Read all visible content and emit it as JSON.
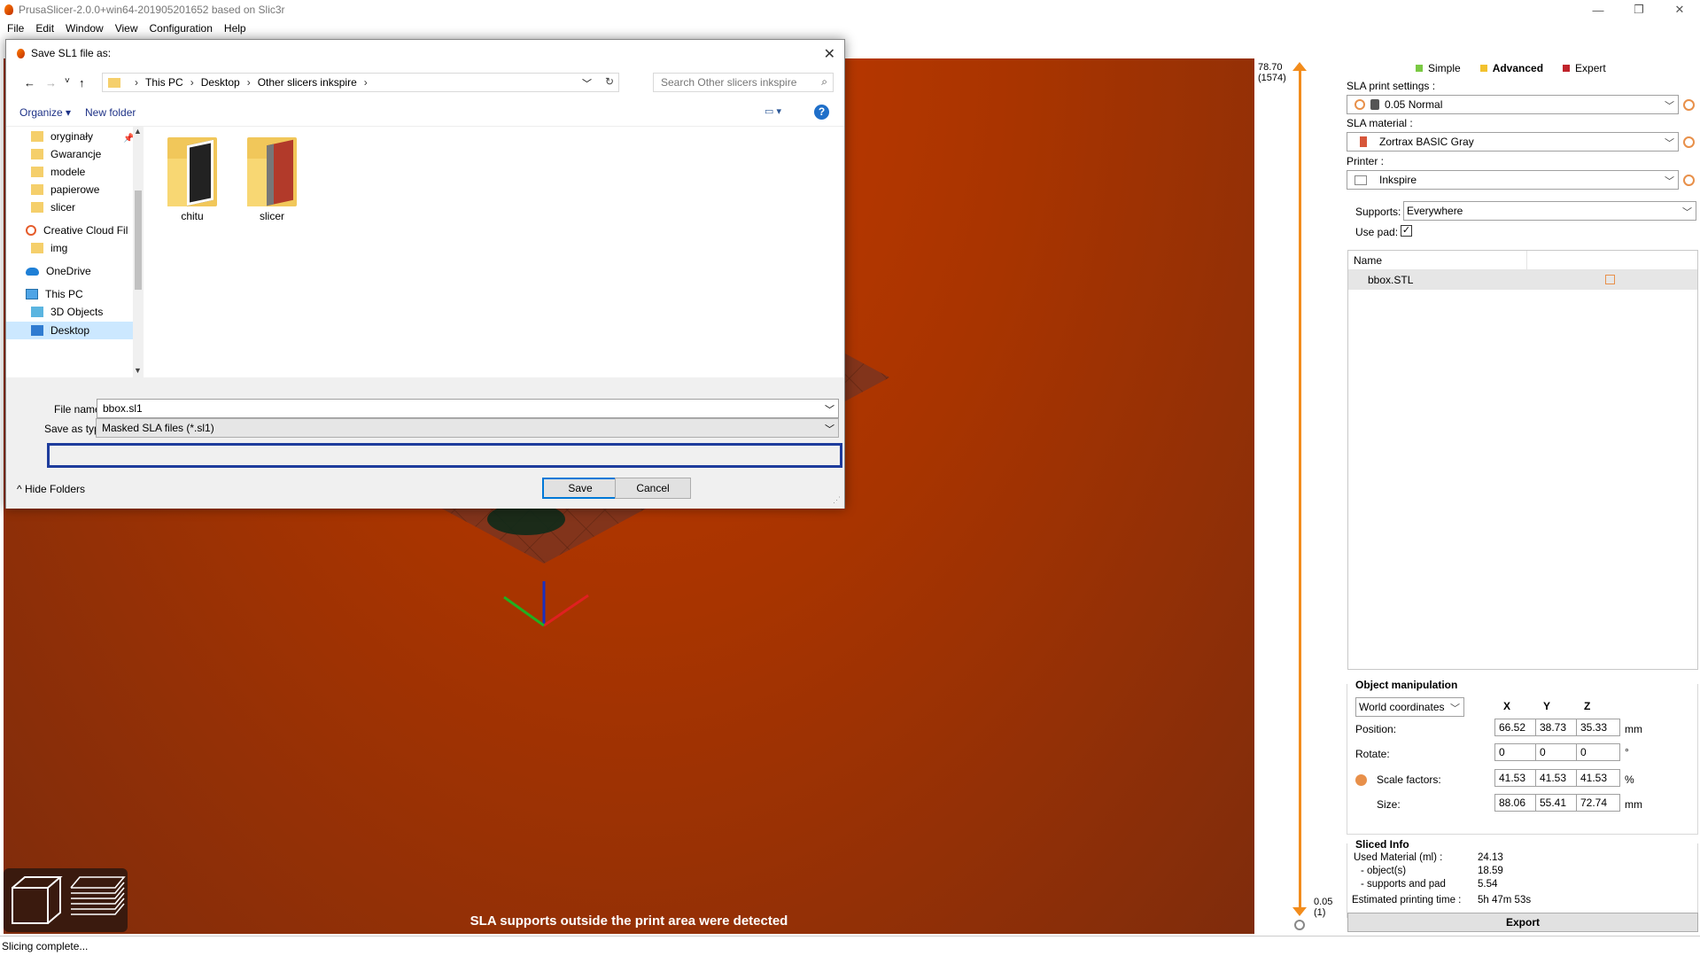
{
  "app": {
    "title": "PrusaSlicer-2.0.0+win64-201905201652 based on Slic3r",
    "window_controls": [
      "—",
      "❐",
      "✕"
    ],
    "menu": [
      "File",
      "Edit",
      "Window",
      "View",
      "Configuration",
      "Help"
    ]
  },
  "viewport": {
    "warning": "SLA supports outside the print area were detected",
    "background_color": "#a83400"
  },
  "layer_slider": {
    "top_value": "78.70",
    "top_layer": "(1574)",
    "bottom_value": "0.05",
    "bottom_layer": "(1)",
    "accent": "#f28c1c"
  },
  "sidebar": {
    "modes": [
      {
        "label": "Simple",
        "color": "#7ac943"
      },
      {
        "label": "Advanced",
        "color": "#f2c12e"
      },
      {
        "label": "Expert",
        "color": "#c0232b"
      }
    ],
    "print_settings_label": "SLA print settings :",
    "print_settings_value": "0.05 Normal",
    "material_label": "SLA material :",
    "material_value": "Zortrax BASIC Gray",
    "printer_label": "Printer :",
    "printer_value": "Inkspire",
    "supports_label": "Supports:",
    "supports_value": "Everywhere",
    "use_pad_label": "Use pad:",
    "use_pad_checked": true,
    "object_list": {
      "column_name": "Name",
      "items": [
        "bbox.STL"
      ]
    },
    "object_manipulation": {
      "title": "Object manipulation",
      "coord_system": "World coordinates",
      "axes": [
        "X",
        "Y",
        "Z"
      ],
      "position_label": "Position:",
      "position": [
        "66.52",
        "38.73",
        "35.33"
      ],
      "position_unit": "mm",
      "rotate_label": "Rotate:",
      "rotate": [
        "0",
        "0",
        "0"
      ],
      "rotate_unit": "°",
      "scale_label": "Scale factors:",
      "scale": [
        "41.53",
        "41.53",
        "41.53"
      ],
      "scale_unit": "%",
      "size_label": "Size:",
      "size": [
        "88.06",
        "55.41",
        "72.74"
      ],
      "size_unit": "mm"
    },
    "sliced_info": {
      "title": "Sliced Info",
      "used_material_label": "Used Material (ml) :",
      "used_material_value": "24.13",
      "objects_label": "- object(s)",
      "objects_value": "18.59",
      "supports_pad_label": "- supports and pad",
      "supports_pad_value": "5.54",
      "print_time_label": "Estimated printing time :",
      "print_time_value": "5h 47m 53s"
    },
    "export_label": "Export"
  },
  "status_bar": "Slicing complete...",
  "dialog": {
    "title": "Save SL1 file as:",
    "close": "✕",
    "breadcrumb": [
      "This PC",
      "Desktop",
      "Other slicers inkspire"
    ],
    "search_placeholder": "Search Other slicers inkspire",
    "organize_label": "Organize ▾",
    "new_folder_label": "New folder",
    "nav_items": [
      {
        "label": "oryginały",
        "type": "folder"
      },
      {
        "label": "Gwarancje",
        "type": "folder"
      },
      {
        "label": "modele",
        "type": "folder"
      },
      {
        "label": "papierowe",
        "type": "folder"
      },
      {
        "label": "slicer",
        "type": "folder"
      },
      {
        "label": "Creative Cloud Fil",
        "type": "creative-cloud"
      },
      {
        "label": "img",
        "type": "folder"
      },
      {
        "label": "OneDrive",
        "type": "onedrive"
      },
      {
        "label": "This PC",
        "type": "this-pc"
      },
      {
        "label": "3D Objects",
        "type": "objects"
      },
      {
        "label": "Desktop",
        "type": "desktop"
      }
    ],
    "files": [
      {
        "label": "chitu",
        "paper_color": "#222222"
      },
      {
        "label": "slicer",
        "paper_color": "#b23a2a"
      }
    ],
    "file_name_label": "File name:",
    "file_name_value": "bbox.sl1",
    "save_type_label": "Save as type:",
    "save_type_value": "Masked SLA files (*.sl1)",
    "hide_folders_label": "Hide Folders",
    "save_label": "Save",
    "cancel_label": "Cancel"
  }
}
